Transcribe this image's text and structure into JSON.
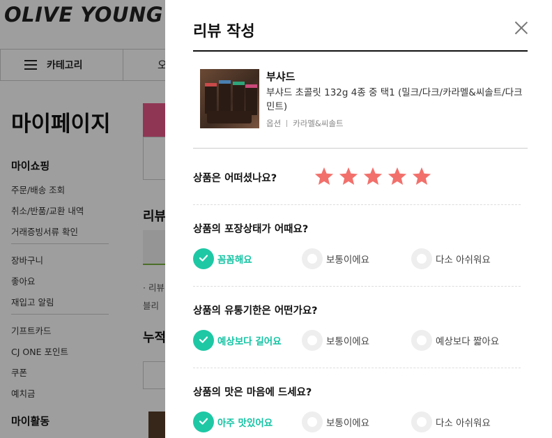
{
  "background": {
    "logo": "OLIVE YOUNG",
    "category_label": "카테고리",
    "nav_next_partial": "오",
    "mypage_title": "마이페이지",
    "sections": [
      {
        "title": "마이쇼핑",
        "items": [
          "주문/배송 조회",
          "취소/반품/교환 내역",
          "거래증빙서류 확인"
        ]
      },
      {
        "title": "",
        "items": [
          "장바구니",
          "좋아요",
          "재입고 알림"
        ]
      },
      {
        "title": "",
        "items": [
          "기프트카드",
          "CJ ONE 포인트",
          "쿠폰",
          "예치금"
        ]
      },
      {
        "title": "마이활동",
        "items": []
      }
    ],
    "content_heading_1": "리뷰",
    "content_text_1": "· 리뷰",
    "content_text_2": "블리",
    "content_heading_2": "누적"
  },
  "modal": {
    "title": "리뷰 작성",
    "product": {
      "brand": "부샤드",
      "name": "부샤드 초콜릿 132g 4종 중 택1 (밀크/다크/카라멜&씨솔트/다크민트)",
      "option_label": "옵션",
      "option_value": "카라멜&씨솔트"
    },
    "rating": {
      "question": "상품은 어떠셨나요?",
      "stars": 5,
      "max": 5,
      "star_color": "#f2706b"
    },
    "questions": [
      {
        "question": "상품의 포장상태가 어때요?",
        "options": [
          "꼼꼼해요",
          "보통이에요",
          "다소 아쉬워요"
        ],
        "selected": 0
      },
      {
        "question": "상품의 유통기한은 어떤가요?",
        "options": [
          "예상보다 길어요",
          "보통이에요",
          "예상보다 짧아요"
        ],
        "selected": 0
      },
      {
        "question": "상품의 맛은 마음에 드세요?",
        "options": [
          "아주 맛있어요",
          "보통이에요",
          "다소 아쉬워요"
        ],
        "selected": 0
      }
    ],
    "accent_color": "#1ec8a5"
  }
}
